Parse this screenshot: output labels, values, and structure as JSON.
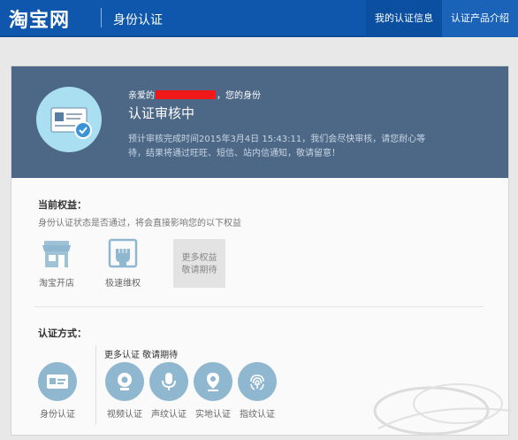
{
  "header": {
    "logo": "淘宝网",
    "page_name": "身份认证",
    "nav": [
      {
        "label": "我的认证信息"
      },
      {
        "label": "认证产品介绍"
      }
    ]
  },
  "status_banner": {
    "greeting_prefix": "亲爱的",
    "greeting_suffix": "，您的身份",
    "status": "认证审核中",
    "estimate": "预计审核完成时间2015年3月4日 15:43:11，我们会尽快审核，请您耐心等待，结果将通过旺旺、短信、站内信通知，敬请留意！"
  },
  "benefits": {
    "title": "当前权益：",
    "description": "身份认证状态是否通过，将会直接影响您的以下权益",
    "items": [
      {
        "label": "淘宝开店",
        "icon": "shop-icon"
      },
      {
        "label": "极速维权",
        "icon": "fist-icon"
      }
    ],
    "more_line1": "更多权益",
    "more_line2": "敬请期待"
  },
  "methods": {
    "title": "认证方式：",
    "identity": {
      "label": "身份认证",
      "icon": "id-card-icon"
    },
    "more_title": "更多认证 敬请期待",
    "items": [
      {
        "label": "视频认证",
        "icon": "camera-icon"
      },
      {
        "label": "声纹认证",
        "icon": "microphone-icon"
      },
      {
        "label": "实地认证",
        "icon": "location-pin-icon"
      },
      {
        "label": "指纹认证",
        "icon": "fingerprint-icon"
      }
    ]
  },
  "colors": {
    "header": "#0e57ad",
    "banner": "#4c6886",
    "icon_circle": "#8fb7cf",
    "redaction": "#f01818"
  }
}
